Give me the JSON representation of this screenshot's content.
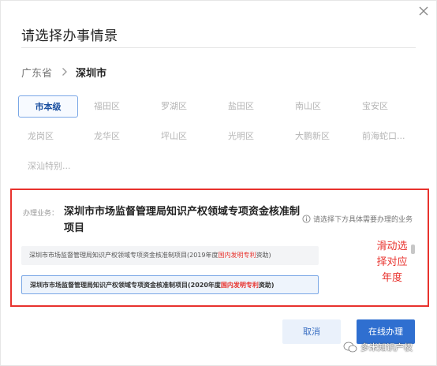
{
  "dialog": {
    "title": "请选择办事情景"
  },
  "breadcrumb": {
    "province": "广东省",
    "city": "深圳市"
  },
  "districts": [
    "市本级",
    "福田区",
    "罗湖区",
    "盐田区",
    "南山区",
    "宝安区",
    "龙岗区",
    "龙华区",
    "坪山区",
    "光明区",
    "大鹏新区",
    "前海蛇口...",
    "深汕特别..."
  ],
  "business": {
    "label": "办理业务：",
    "title": "深圳市市场监督管理局知识产权领域专项资金核准制项目",
    "hint": "请选择下方具体需要办理的业务",
    "options": [
      {
        "prefix": "深圳市市场监督管理局知识产权领域专项资金核准制项目(2019年度",
        "highlight": "国内发明专利",
        "suffix": "资助)"
      },
      {
        "prefix": "深圳市市场监督管理局知识产权领域专项资金核准制项目(2020年度",
        "highlight": "国内发明专利",
        "suffix": "资助)"
      }
    ],
    "annotation": "滑动选择对应年度"
  },
  "buttons": {
    "cancel": "取消",
    "submit": "在线办理"
  },
  "watermark": "多米知识产权",
  "colors": {
    "accent": "#2f6fd0",
    "annotation_red": "#e8322d"
  }
}
